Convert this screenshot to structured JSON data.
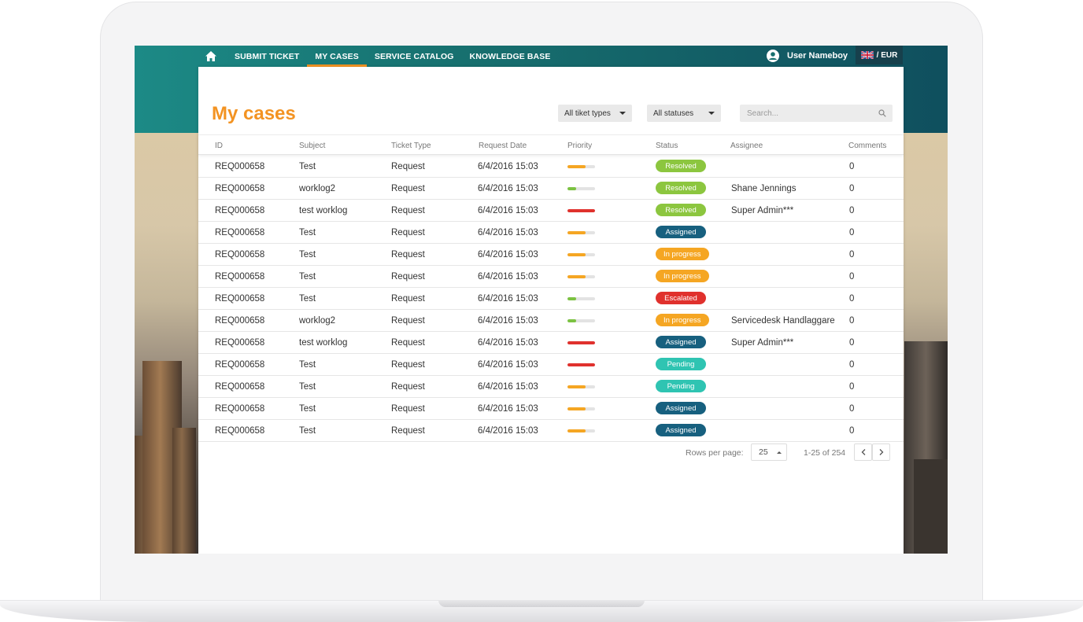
{
  "nav": {
    "items": [
      {
        "label": "SUBMIT TICKET",
        "active": false
      },
      {
        "label": "MY CASES",
        "active": true
      },
      {
        "label": "SERVICE CATALOG",
        "active": false
      },
      {
        "label": "KNOWLEDGE BASE",
        "active": false
      }
    ],
    "user_name": "User Nameboy",
    "currency": "/ EUR"
  },
  "page": {
    "title": "My cases",
    "filter_type": "All tiket types",
    "filter_status": "All statuses",
    "search_placeholder": "Search..."
  },
  "table": {
    "columns": [
      "ID",
      "Subject",
      "Ticket Type",
      "Request Date",
      "Priority",
      "Status",
      "Assignee",
      "Comments"
    ],
    "rows": [
      {
        "id": "REQ000658",
        "subject": "Test",
        "type": "Request",
        "date": "6/4/2016 15:03",
        "priority": "medium",
        "status": "Resolved",
        "assignee": "",
        "comments": "0"
      },
      {
        "id": "REQ000658",
        "subject": "worklog2",
        "type": "Request",
        "date": "6/4/2016 15:03",
        "priority": "low",
        "status": "Resolved",
        "assignee": "Shane Jennings",
        "comments": "0"
      },
      {
        "id": "REQ000658",
        "subject": "test worklog",
        "type": "Request",
        "date": "6/4/2016 15:03",
        "priority": "high",
        "status": "Resolved",
        "assignee": "Super Admin***",
        "comments": "0"
      },
      {
        "id": "REQ000658",
        "subject": "Test",
        "type": "Request",
        "date": "6/4/2016 15:03",
        "priority": "medium",
        "status": "Assigned",
        "assignee": "",
        "comments": "0"
      },
      {
        "id": "REQ000658",
        "subject": "Test",
        "type": "Request",
        "date": "6/4/2016 15:03",
        "priority": "medium",
        "status": "In progress",
        "assignee": "",
        "comments": "0"
      },
      {
        "id": "REQ000658",
        "subject": "Test",
        "type": "Request",
        "date": "6/4/2016 15:03",
        "priority": "medium",
        "status": "In progress",
        "assignee": "",
        "comments": "0"
      },
      {
        "id": "REQ000658",
        "subject": "Test",
        "type": "Request",
        "date": "6/4/2016 15:03",
        "priority": "low",
        "status": "Escalated",
        "assignee": "",
        "comments": "0"
      },
      {
        "id": "REQ000658",
        "subject": "worklog2",
        "type": "Request",
        "date": "6/4/2016 15:03",
        "priority": "low",
        "status": "In progress",
        "assignee": "Servicedesk Handlaggare",
        "comments": "0"
      },
      {
        "id": "REQ000658",
        "subject": "test worklog",
        "type": "Request",
        "date": "6/4/2016 15:03",
        "priority": "high",
        "status": "Assigned",
        "assignee": "Super Admin***",
        "comments": "0"
      },
      {
        "id": "REQ000658",
        "subject": "Test",
        "type": "Request",
        "date": "6/4/2016 15:03",
        "priority": "high",
        "status": "Pending",
        "assignee": "",
        "comments": "0"
      },
      {
        "id": "REQ000658",
        "subject": "Test",
        "type": "Request",
        "date": "6/4/2016 15:03",
        "priority": "medium",
        "status": "Pending",
        "assignee": "",
        "comments": "0"
      },
      {
        "id": "REQ000658",
        "subject": "Test",
        "type": "Request",
        "date": "6/4/2016 15:03",
        "priority": "medium",
        "status": "Assigned",
        "assignee": "",
        "comments": "0"
      },
      {
        "id": "REQ000658",
        "subject": "Test",
        "type": "Request",
        "date": "6/4/2016 15:03",
        "priority": "medium",
        "status": "Assigned",
        "assignee": "",
        "comments": "0"
      }
    ]
  },
  "priority_levels": {
    "low": {
      "fill": 0.3,
      "color": "#7cc242"
    },
    "medium": {
      "fill": 0.65,
      "color": "#f5a623"
    },
    "high": {
      "fill": 1.0,
      "color": "#e0312d"
    }
  },
  "status_colors": {
    "Resolved": "#8cc63f",
    "Assigned": "#17607f",
    "In progress": "#f5a623",
    "Escalated": "#e0312d",
    "Pending": "#2fc4b2"
  },
  "pager": {
    "rows_label": "Rows per page:",
    "rows_value": "25",
    "range": "1-25 of 254"
  },
  "colors": {
    "accent": "#f39322",
    "header_teal": "#17706f"
  }
}
